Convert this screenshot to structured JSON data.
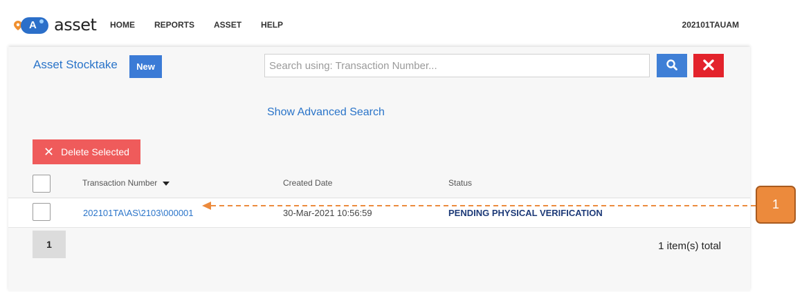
{
  "app": {
    "logo_letter": "A",
    "logo_text": "asset"
  },
  "nav": {
    "items": [
      "HOME",
      "REPORTS",
      "ASSET",
      "HELP"
    ]
  },
  "user": {
    "name": "202101TAUAM"
  },
  "page": {
    "title": "Asset Stocktake",
    "new_label": "New",
    "search_placeholder": "Search using: Transaction Number...",
    "advanced_search": "Show Advanced Search",
    "delete_label": "Delete Selected"
  },
  "table": {
    "headers": {
      "transaction": "Transaction Number",
      "created": "Created Date",
      "status": "Status"
    },
    "rows": [
      {
        "transaction": "202101TA\\AS\\2103\\000001",
        "created": "30-Mar-2021 10:56:59",
        "status": "PENDING PHYSICAL VERIFICATION"
      }
    ]
  },
  "pagination": {
    "current_page": "1",
    "total": "1 item(s) total"
  },
  "annotation": {
    "label": "1"
  },
  "colors": {
    "accent": "#2a74c9",
    "danger": "#e3232c",
    "annotation": "#ec8a3c"
  }
}
